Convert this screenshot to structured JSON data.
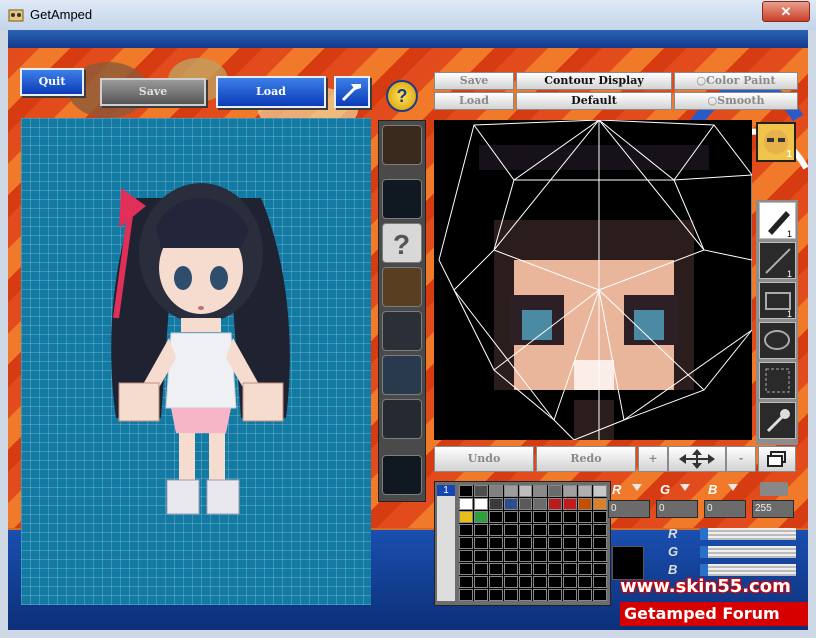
{
  "window": {
    "title": "GetAmped",
    "close_glyph": "✕"
  },
  "toolbar": {
    "quit": "Quit",
    "save": "Save",
    "load": "Load"
  },
  "editor_menu": {
    "save": "Save",
    "load": "Load",
    "contour_display": "Contour Display",
    "default": "Default",
    "color_paint": "Color Paint",
    "smooth": "Smooth"
  },
  "edit_actions": {
    "undo": "Undo",
    "redo": "Redo",
    "plus": "+",
    "minus": "-"
  },
  "counters": {
    "face_count": "1",
    "pen_count": "1",
    "line_count": "1",
    "rect_count": "1",
    "palette_page": "1"
  },
  "rgb": {
    "r_label": "R",
    "g_label": "G",
    "b_label": "B",
    "r_value": "0",
    "g_value": "0",
    "b_value": "0",
    "a_value": "255",
    "r_side": "R",
    "g_side": "G",
    "b_side": "B"
  },
  "palette_colors": [
    "#000000",
    "#4d4d4d",
    "#808080",
    "#9e9e9e",
    "#bdbdbd",
    "#8a8a8a",
    "#6b6b6b",
    "#a0a0a0",
    "#b0b0b0",
    "#c8c8c8",
    "#ffffff",
    "#ffffff",
    "#3a3a3a",
    "#2d4d8c",
    "#5a5a5a",
    "#6c6c6c",
    "#ba1c1c",
    "#c41a1a",
    "#c84f00",
    "#d8802a",
    "#e6c018",
    "#2ea03c"
  ],
  "watermark": {
    "site": "www.skin55.com",
    "forum": "Getamped Forum"
  },
  "colors": {
    "accent_blue": "#0b3bb8",
    "viewport_bg": "#137aa3",
    "watermark_red": "#d60000"
  }
}
